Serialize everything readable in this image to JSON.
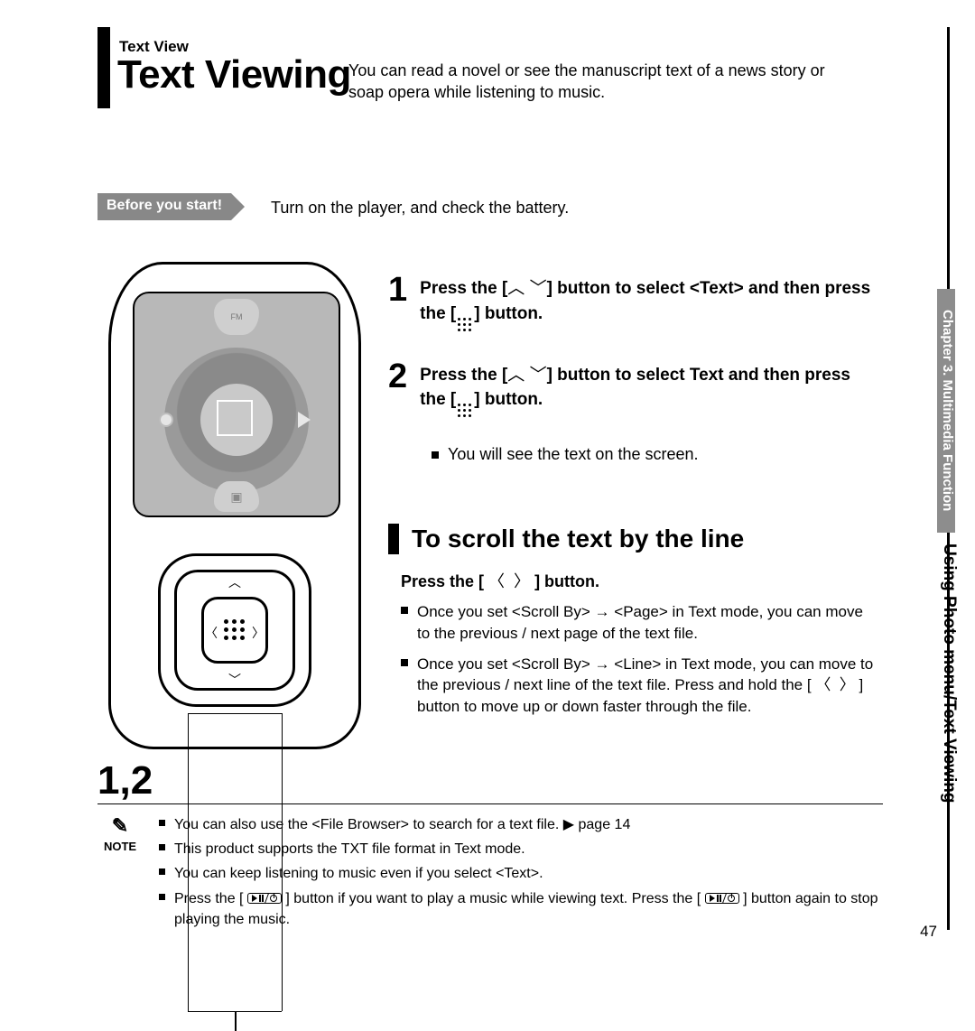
{
  "eyebrow": "Text View",
  "title": "Text Viewing",
  "intro": "You can read a novel or see the manuscript text of a news story or soap opera while listening to music.",
  "before_tag": "Before you start!",
  "before_text": "Turn on the player, and check the battery.",
  "step1": {
    "num": "1",
    "line_a": "Press the [",
    "line_b": "] button to select <Text> and then press the [",
    "line_c": "] button."
  },
  "step2": {
    "num": "2",
    "line_a": "Press the [",
    "line_b": "] button to select Text and then press the [",
    "line_c": "] button.",
    "sub": "You will see the text on the screen."
  },
  "section_title": "To scroll the text by the line",
  "section_lead_a": "Press the [ ",
  "section_lead_b": " ] button.",
  "bullet_page": "Once you set <Scroll By> → <Page> in Text mode, you can move to the previous / next page of the text file.",
  "bullet_line_a": "Once you set <Scroll By> → <Line> in Text mode, you can move to the previous / next line of the text file. Press and hold the [ ",
  "bullet_line_b": " ] button to move up or down faster through the file.",
  "step_label": "1,2",
  "note_label": "NOTE",
  "notes": {
    "n1": "You can also use the <File Browser> to search for a text file. ▶ page 14",
    "n2": "This product supports the TXT file format in Text mode.",
    "n3": "You can keep listening to music even if you select <Text>.",
    "n4_a": "Press the [",
    "n4_b": "] button if you want to play a music while viewing text. Press the [",
    "n4_c": "] button again to stop playing the music."
  },
  "side_chapter": "Chapter 3. Multimedia Function",
  "side_title": "Using Photo menu/Text Viewing",
  "page_num": "47",
  "fm_label": "FM"
}
